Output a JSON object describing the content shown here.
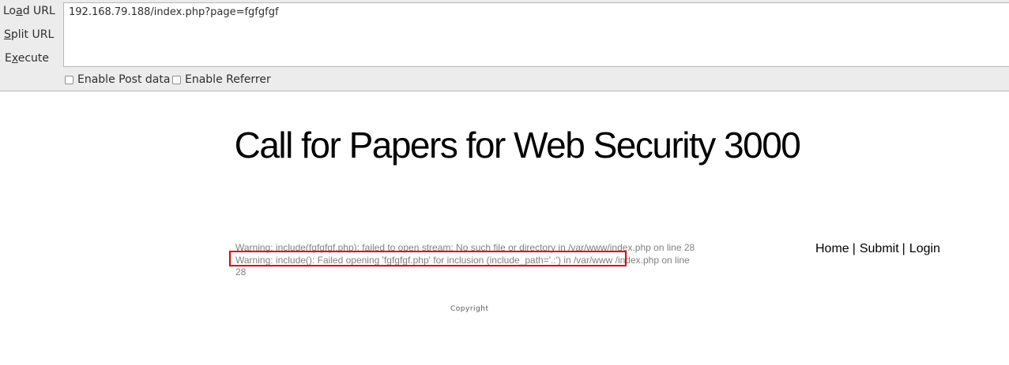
{
  "hackbar": {
    "load_url_pre": "Lo",
    "load_url_ul": "a",
    "load_url_post": "d URL",
    "split_url_pre": "",
    "split_url_ul": "S",
    "split_url_post": "plit URL",
    "execute_pre": "E",
    "execute_ul": "x",
    "execute_post": "ecute",
    "url_value": "192.168.79.188/index.php?page=fgfgfgf",
    "enable_post_label": "Enable Post data",
    "enable_referrer_label": "Enable Referrer"
  },
  "page": {
    "title": "Call for Papers for Web Security 3000",
    "warning_text": "Warning: include(fgfgfgf.php): failed to open stream: No such file or directory in /var/www/index.php on line 28 Warning: include(): Failed opening 'fgfgfgf.php' for inclusion (include_path='.:') in /var/www /index.php on line 28",
    "nav": {
      "home": "Home",
      "submit": "Submit",
      "login": "Login",
      "separator": "|"
    },
    "copyright": "Copyright"
  },
  "colors": {
    "highlight_border": "#e00000",
    "warning_text": "#808080",
    "hackbar_bg": "#ececec"
  }
}
